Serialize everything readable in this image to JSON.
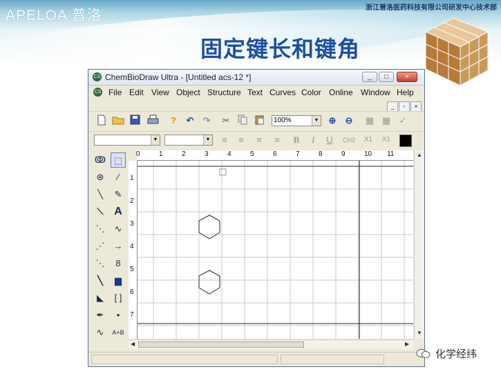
{
  "slide": {
    "logo_text": "APELOA 普洛",
    "company": "浙江普洛医药科技有限公司研发中心技术部",
    "title": "固定键长和键角"
  },
  "window": {
    "title": "ChemBioDraw Ultra - [Untitled acs-12 *]",
    "app_icon_text": "CS",
    "controls": [
      "_",
      "□",
      "×"
    ]
  },
  "menu": [
    "File",
    "Edit",
    "View",
    "Object",
    "Structure",
    "Text",
    "Curves",
    "Color",
    "Online",
    "Window",
    "Help"
  ],
  "doc_controls": [
    "_",
    "▫",
    "×"
  ],
  "toolbar": {
    "zoom_value": "100%",
    "icons": [
      "new-file-icon",
      "open-folder-icon",
      "save-icon",
      "print-icon",
      "help-icon",
      "undo-icon",
      "redo-icon",
      "cut-icon",
      "copy-icon",
      "paste-icon",
      "zoom-in-icon",
      "zoom-out-icon",
      "check-icon"
    ]
  },
  "format_bar": {
    "font_select": "",
    "size_select": "",
    "labels": [
      "B",
      "I",
      "U",
      "CH2",
      "X1",
      "X1"
    ],
    "text_color": "#000000"
  },
  "palette": {
    "icons": [
      "lasso-icon",
      "select-arrow-icon",
      "rotate-icon",
      "mass-fragment-icon",
      "bond-icon",
      "eraser-icon",
      "bold-bond-icon",
      "text-tool-icon",
      "dashed-bond-icon",
      "chain-icon",
      "hashed-bond-icon",
      "arrow-icon",
      "wavy-bond-icon",
      "orbital-icon",
      "wedge-bond-icon",
      "rectangle-icon",
      "hashed-wedge-icon",
      "bracket-icon",
      "pen-icon",
      "charge-icon",
      "wavy-line-icon",
      "reaction-icon"
    ],
    "text_tool_label": "A",
    "reaction_label": "A+B"
  },
  "rulers": {
    "horizontal": [
      "0",
      "1",
      "2",
      "3",
      "4",
      "5",
      "6",
      "7",
      "8",
      "9",
      "10",
      "11"
    ],
    "vertical": [
      "1",
      "2",
      "3",
      "4",
      "5",
      "6",
      "7"
    ]
  },
  "watermark": "化学经纬"
}
